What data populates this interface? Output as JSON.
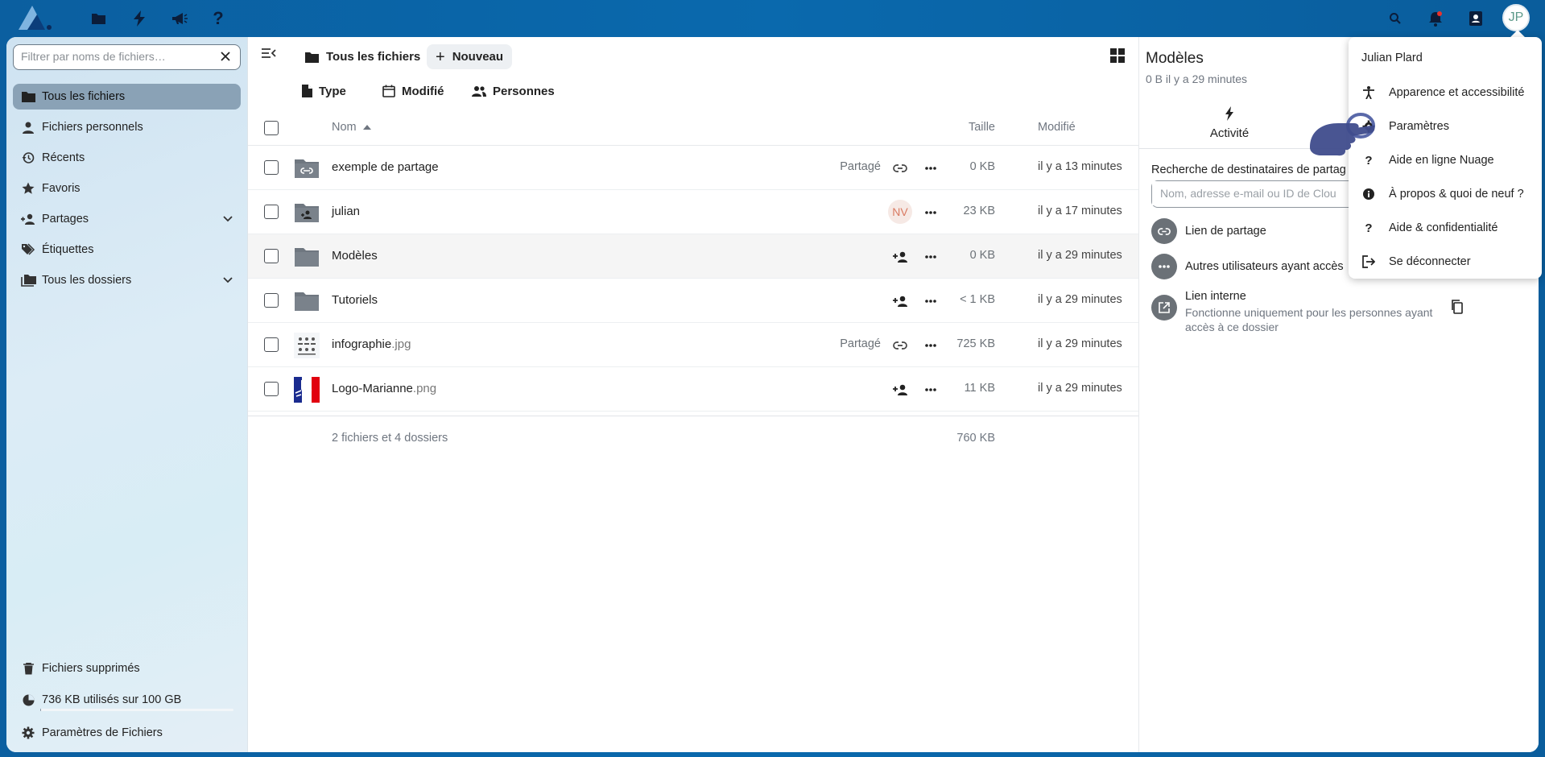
{
  "header": {
    "apps": [
      {
        "name": "files-app",
        "icon": "folder-icon"
      },
      {
        "name": "activity-app",
        "icon": "lightning-icon"
      },
      {
        "name": "announcements-app",
        "icon": "megaphone-icon"
      },
      {
        "name": "help-app",
        "icon": "question-icon"
      }
    ],
    "right_icons": [
      "search-icon",
      "notifications-icon",
      "contacts-icon"
    ],
    "avatar_initials": "JP"
  },
  "nav": {
    "filter_placeholder": "Filtrer par noms de fichiers…",
    "items": [
      {
        "label": "Tous les fichiers",
        "icon": "folder-icon",
        "active": true
      },
      {
        "label": "Fichiers personnels",
        "icon": "user-icon"
      },
      {
        "label": "Récents",
        "icon": "history-icon"
      },
      {
        "label": "Favoris",
        "icon": "star-icon"
      },
      {
        "label": "Partages",
        "icon": "share-user-icon",
        "expandable": true
      },
      {
        "label": "Étiquettes",
        "icon": "tag-icon"
      },
      {
        "label": "Tous les dossiers",
        "icon": "folders-icon",
        "expandable": true
      }
    ],
    "deleted_label": "Fichiers supprimés",
    "quota_label": "736 KB utilisés sur 100 GB",
    "quota_fraction": 1e-05,
    "settings_label": "Paramètres de Fichiers"
  },
  "files": {
    "breadcrumb": "Tous les fichiers",
    "new_button": "Nouveau",
    "filters": [
      "Type",
      "Modifié",
      "Personnes"
    ],
    "columns": {
      "name": "Nom",
      "size": "Taille",
      "modified": "Modifié"
    },
    "rows": [
      {
        "name": "exemple de partage",
        "ext": "",
        "kind": "link-folder",
        "shared_label": "Partagé",
        "share_icon": "link-icon",
        "size": "0 KB",
        "modified": "il y a 13 minutes"
      },
      {
        "name": "julian",
        "ext": "",
        "kind": "shared-folder",
        "shared_label": "",
        "avatar": "NV",
        "size": "23 KB",
        "modified": "il y a 17 minutes"
      },
      {
        "name": "Modèles",
        "ext": "",
        "kind": "folder",
        "shared_label": "",
        "share_icon": "add-user-icon",
        "size": "0 KB",
        "modified": "il y a 29 minutes"
      },
      {
        "name": "Tutoriels",
        "ext": "",
        "kind": "folder",
        "shared_label": "",
        "share_icon": "add-user-icon",
        "size": "< 1 KB",
        "modified": "il y a 29 minutes"
      },
      {
        "name": "infographie",
        "ext": ".jpg",
        "kind": "image-infographic",
        "shared_label": "Partagé",
        "share_icon": "link-icon",
        "size": "725 KB",
        "modified": "il y a 29 minutes"
      },
      {
        "name": "Logo-Marianne",
        "ext": ".png",
        "kind": "image-marianne",
        "shared_label": "",
        "share_icon": "add-user-icon",
        "size": "11 KB",
        "modified": "il y a 29 minutes"
      }
    ],
    "summary": "2 fichiers et 4 dossiers",
    "summary_size": "760 KB"
  },
  "sidebar": {
    "title": "Modèles",
    "subtitle": "0 B il y a 29 minutes",
    "tab_activity": "Activité",
    "search_label": "Recherche de destinataires de partag",
    "search_placeholder": "Nom, adresse e-mail ou ID de Clou",
    "share_link": "Lien de partage",
    "others_access": "Autres utilisateurs ayant accès",
    "internal_title": "Lien interne",
    "internal_desc": "Fonctionne uniquement pour les personnes ayant accès à ce dossier"
  },
  "user_menu": {
    "user_name": "Julian Plard",
    "items": [
      {
        "label": "Apparence et accessibilité",
        "icon": "accessibility-icon"
      },
      {
        "label": "Paramètres",
        "icon": "settings-icon"
      },
      {
        "label": "Aide en ligne Nuage",
        "icon": "question-icon"
      },
      {
        "label": "À propos & quoi de neuf ?",
        "icon": "info-icon"
      },
      {
        "label": "Aide & confidentialité",
        "icon": "question-icon"
      },
      {
        "label": "Se déconnecter",
        "icon": "logout-icon"
      }
    ]
  },
  "colors": {
    "header": "#0a66aa",
    "nav_active": "#8aa2b6",
    "folder": "#6f7780"
  }
}
